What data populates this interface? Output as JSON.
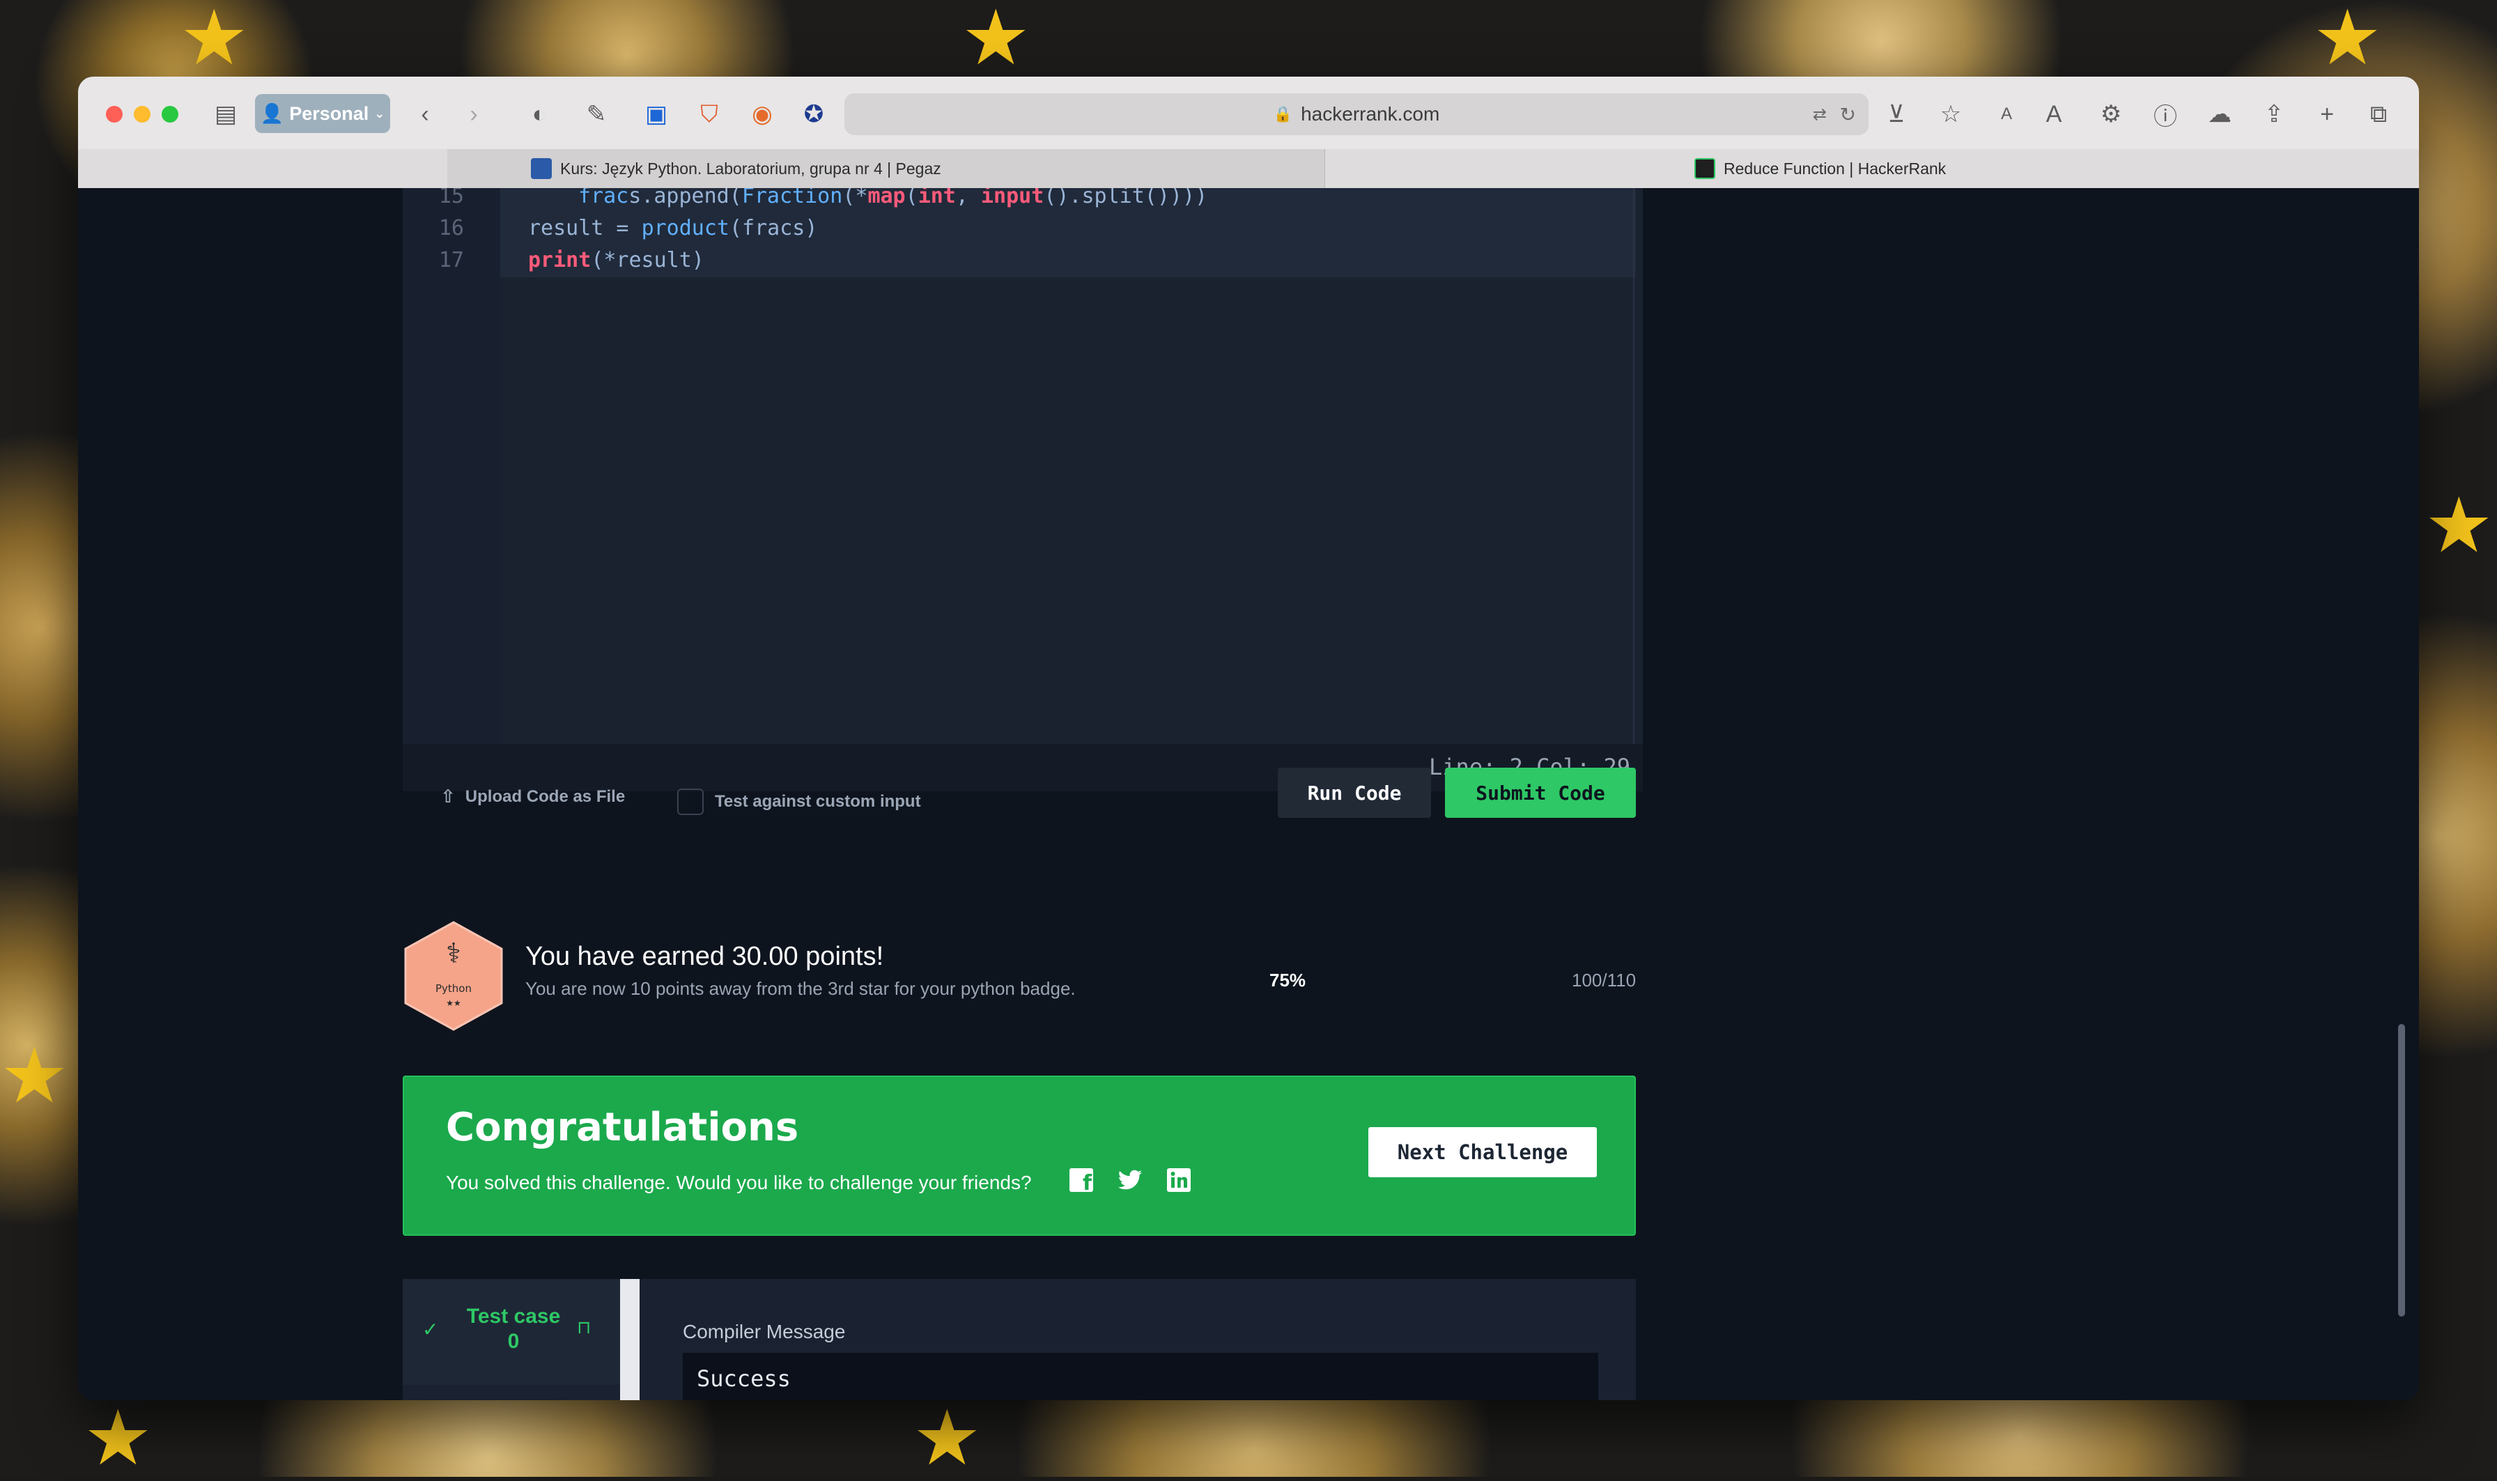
{
  "browser": {
    "profile": "Personal",
    "address": "hackerrank.com",
    "tabs": [
      {
        "title": "Kurs: Język Python. Laboratorium, grupa nr 4 | Pegaz",
        "active": false
      },
      {
        "title": "Reduce Function | HackerRank",
        "active": true
      }
    ]
  },
  "editor": {
    "lines": [
      {
        "num": "15",
        "text": "frac"
      },
      {
        "num": "16",
        "text": "result"
      },
      {
        "num": "17",
        "text": "print"
      }
    ],
    "status": "Line: 2 Col: 29"
  },
  "actions": {
    "upload_label": "Upload Code as File",
    "custom_input_label": "Test against custom input",
    "run_label": "Run Code",
    "submit_label": "Submit Code"
  },
  "points": {
    "badge_label": "Python",
    "badge_stars": "★★",
    "earned": "You have earned 30.00 points!",
    "away": "You are now 10 points away from the 3rd star for your python badge.",
    "percent": "75%",
    "progress": 0.75,
    "score": "100/110"
  },
  "congrats": {
    "title": "Congratulations",
    "subtitle": "You solved this challenge. Would you like to challenge your friends?",
    "next_label": "Next Challenge"
  },
  "results": {
    "test_case_label": "Test case",
    "test_case_num": "0",
    "compiler_message_label": "Compiler Message",
    "compiler_message": "Success"
  },
  "colors": {
    "accent_green": "#2ec866",
    "banner_green": "#1ba94c",
    "page_bg": "#0e141e"
  }
}
